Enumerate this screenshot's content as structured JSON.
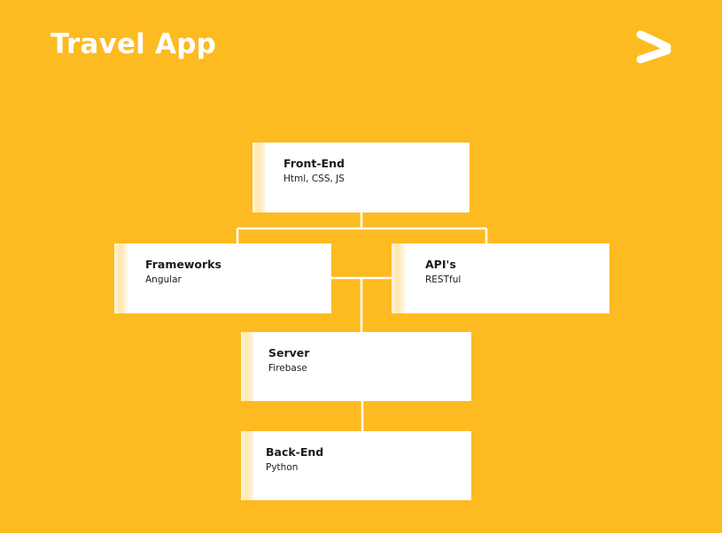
{
  "title": "Travel App",
  "colors": {
    "background": "#FDBA21",
    "box": "#ffffff",
    "line": "#ffffff",
    "accent": "#FFE7AE"
  },
  "logo_icon": "arrow-logo-icon",
  "nodes": {
    "frontend": {
      "title": "Front-End",
      "subtitle": "Html, CSS, JS"
    },
    "frameworks": {
      "title": "Frameworks",
      "subtitle": "Angular"
    },
    "apis": {
      "title": "API's",
      "subtitle": "RESTful"
    },
    "server": {
      "title": "Server",
      "subtitle": "Firebase"
    },
    "backend": {
      "title": "Back-End",
      "subtitle": "Python"
    }
  }
}
